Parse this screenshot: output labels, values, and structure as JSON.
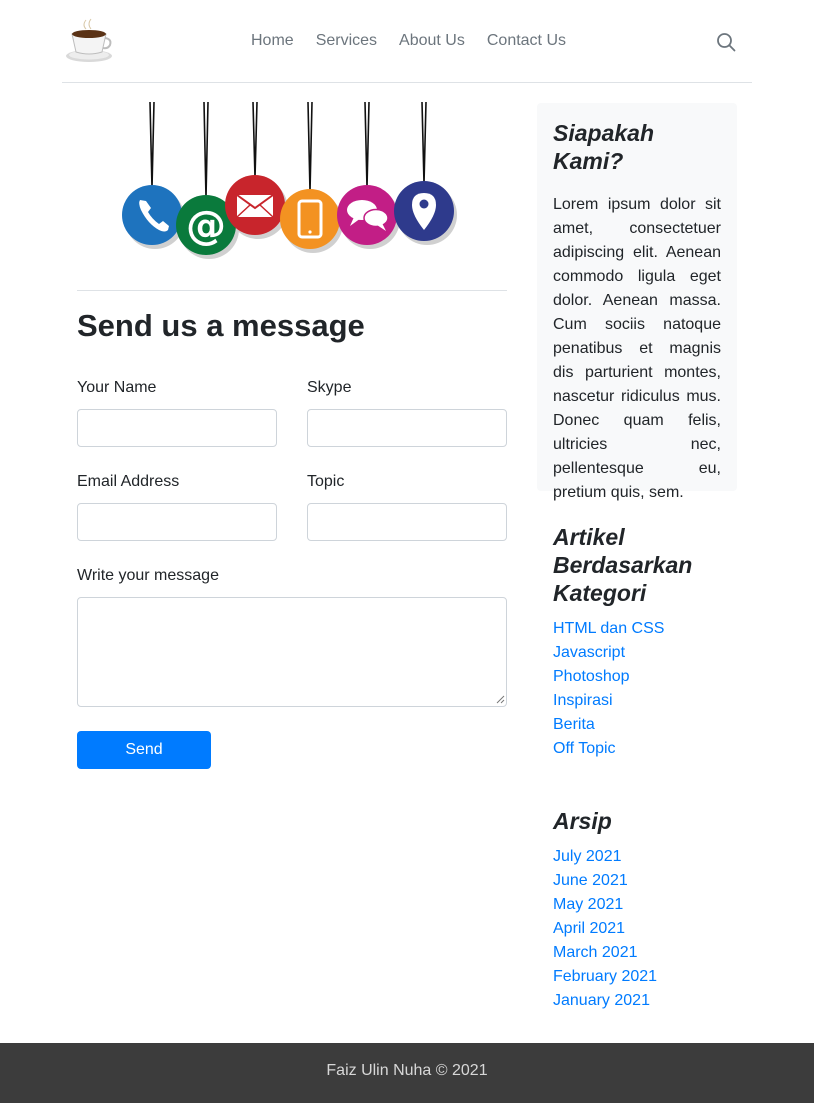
{
  "header": {
    "logo_icon": "coffee-cup-icon",
    "nav": [
      {
        "label": "Home"
      },
      {
        "label": "Services"
      },
      {
        "label": "About Us"
      },
      {
        "label": "Contact Us"
      }
    ],
    "search_icon": "search-icon"
  },
  "hero": {
    "icons": [
      "phone-icon",
      "at-email-icon",
      "envelope-icon",
      "smartphone-icon",
      "chat-bubbles-icon",
      "location-pin-icon"
    ],
    "colors": [
      "#1e73be",
      "#0a7a3c",
      "#c8252c",
      "#f39221",
      "#c21e86",
      "#2e3a8c"
    ]
  },
  "form": {
    "title": "Send us a message",
    "name_label": "Your Name",
    "skype_label": "Skype",
    "email_label": "Email Address",
    "topic_label": "Topic",
    "message_label": "Write your message",
    "name_value": "",
    "skype_value": "",
    "email_value": "",
    "topic_value": "",
    "message_value": "",
    "send_label": "Send"
  },
  "sidebar": {
    "about": {
      "title": "Siapakah Kami?",
      "text": "Lorem ipsum dolor sit amet, consectetuer adipiscing elit. Aenean commodo ligula eget dolor. Aenean massa. Cum sociis natoque penatibus et magnis dis parturient montes, nascetur ridiculus mus. Donec quam felis, ultricies nec, pellentesque eu, pretium quis, sem."
    },
    "categories": {
      "title": "Artikel Berdasarkan Kategori",
      "items": [
        "HTML dan CSS",
        "Javascript",
        "Photoshop",
        "Inspirasi",
        "Berita",
        "Off Topic"
      ]
    },
    "archive": {
      "title": "Arsip",
      "items": [
        "July 2021",
        "June 2021",
        "May 2021",
        "April 2021",
        "March 2021",
        "February 2021",
        "January 2021"
      ]
    }
  },
  "footer": {
    "text": "Faiz Ulin Nuha © 2021"
  },
  "colors": {
    "accent": "#007bff",
    "footer_bg": "#3c3c3c",
    "sidebar_bg": "#f8f9fa"
  }
}
